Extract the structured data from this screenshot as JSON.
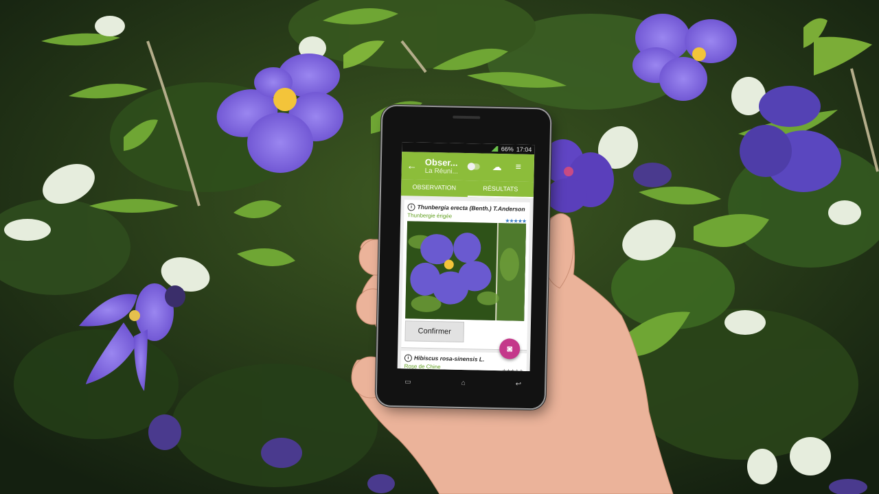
{
  "status_bar": {
    "battery": "66%",
    "time": "17:04"
  },
  "app_bar": {
    "title": "Obser...",
    "subtitle": "La Réuni..."
  },
  "tabs": [
    {
      "label": "OBSERVATION"
    },
    {
      "label": "RÉSULTATS"
    }
  ],
  "results": [
    {
      "scientific_name": "Thunbergia erecta (Benth.) T.Anderson",
      "common_name": "Thunbergie érigée",
      "stars": "★★★★★"
    },
    {
      "scientific_name": "Hibiscus rosa-sinensis L.",
      "common_name": "Rose de Chine",
      "stars": "★★★★★"
    }
  ],
  "confirm_label": "Confirmer",
  "icons": {
    "back": "←",
    "upload": "cloud-upload-icon",
    "filter": "filter-icon",
    "camera": "camera-icon",
    "info": "i"
  },
  "colors": {
    "app_green": "#8cbd3a",
    "fab_pink": "#c4388a",
    "flower_purple": "#7a63d6"
  }
}
